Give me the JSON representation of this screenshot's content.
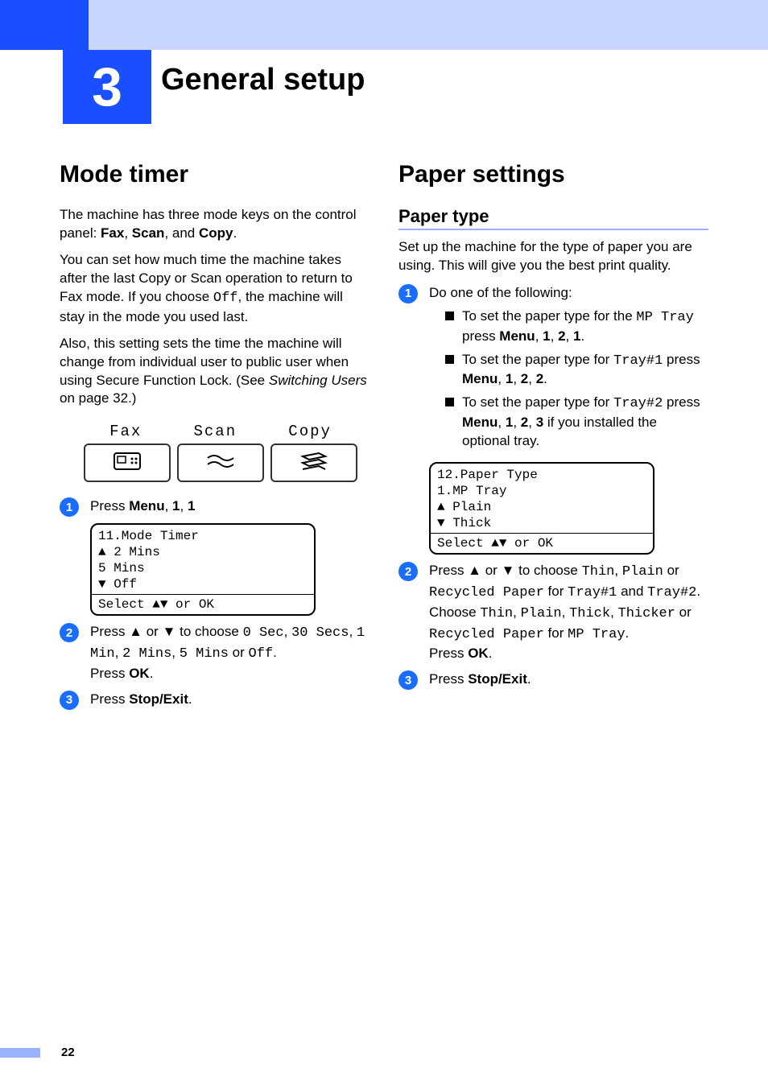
{
  "chapter": {
    "number": "3",
    "title": "General setup"
  },
  "left": {
    "h2": "Mode timer",
    "p1_a": "The machine has three mode keys on the control panel: ",
    "p1_fax": "Fax",
    "p1_sep1": ", ",
    "p1_scan": "Scan",
    "p1_sep2": ", and ",
    "p1_copy": "Copy",
    "p1_end": ".",
    "p2_a": "You can set how much time the machine takes after the last Copy or Scan operation to return to Fax mode. If you choose ",
    "p2_off": "Off",
    "p2_b": ", the machine will stay in the mode you used last.",
    "p3_a": "Also, this setting sets the time the machine will change from individual user to public user when using Secure Function Lock. (See ",
    "p3_i": "Switching Users",
    "p3_b": " on page 32.)",
    "mode_labels": {
      "fax": "Fax",
      "scan": "Scan",
      "copy": "Copy"
    },
    "step1": {
      "num": "1",
      "a": "Press ",
      "menu": "Menu",
      "b": ", ",
      "k1": "1",
      "c": ", ",
      "k2": "1"
    },
    "lcd": {
      "l1": "11.Mode Timer",
      "l2": "▲    2 Mins",
      "l3": "     5 Mins",
      "l4": "▼    Off",
      "l5": "Select ▲▼ or OK"
    },
    "step2": {
      "num": "2",
      "a": "Press ▲ or ▼ to choose ",
      "v1": "0 Sec",
      "s1": ", ",
      "v2": "30 Secs",
      "s2": ", ",
      "v3": "1 Min",
      "s3": ", ",
      "v4": "2 Mins",
      "s4": ", ",
      "v5": "5 Mins",
      "s5": " or ",
      "v6": "Off",
      "s6": ".",
      "b": "Press ",
      "ok": "OK",
      "c": "."
    },
    "step3": {
      "num": "3",
      "a": "Press ",
      "se": "Stop/Exit",
      "b": "."
    }
  },
  "right": {
    "h2": "Paper settings",
    "h3": "Paper type",
    "p1": "Set up the machine for the type of paper you are using. This will give you the best print quality.",
    "step1": {
      "num": "1",
      "a": "Do one of the following:"
    },
    "b1": {
      "a": "To set the paper type for the ",
      "m": "MP Tray",
      "b": " press ",
      "menu": "Menu",
      "s1": ", ",
      "k1": "1",
      "s2": ", ",
      "k2": "2",
      "s3": ", ",
      "k3": "1",
      "end": "."
    },
    "b2": {
      "a": "To set the paper type for ",
      "m": "Tray#1",
      "b": " press ",
      "menu": "Menu",
      "s1": ", ",
      "k1": "1",
      "s2": ", ",
      "k2": "2",
      "s3": ", ",
      "k3": "2",
      "end": "."
    },
    "b3": {
      "a": "To set the paper type for ",
      "m": "Tray#2",
      "b": " press ",
      "menu": "Menu",
      "s1": ", ",
      "k1": "1",
      "s2": ", ",
      "k2": "2",
      "s3": ", ",
      "k3": "3",
      "end": " if you installed the optional tray."
    },
    "lcd": {
      "l1": "12.Paper Type",
      "l2": "  1.MP Tray",
      "l3": "▲    Plain",
      "l4": "▼    Thick",
      "l5": "Select ▲▼ or OK"
    },
    "step2": {
      "num": "2",
      "a": "Press ▲ or ▼ to choose ",
      "v1": "Thin",
      "s1": ", ",
      "v2": "Plain",
      "s2": " or ",
      "v3": "Recycled Paper",
      "s3": " for ",
      "v4": "Tray#1",
      "s4": " and ",
      "v5": "Tray#2",
      "s5": ". Choose ",
      "v6": "Thin",
      "s6": ", ",
      "v7": "Plain",
      "s7": ", ",
      "v8": "Thick",
      "s8": ", ",
      "v9": "Thicker",
      "s9": " or ",
      "v10": "Recycled Paper",
      "s10": " for ",
      "v11": "MP Tray",
      "s11": ".",
      "b": "Press ",
      "ok": "OK",
      "c": "."
    },
    "step3": {
      "num": "3",
      "a": "Press ",
      "se": "Stop/Exit",
      "b": "."
    }
  },
  "page_number": "22"
}
